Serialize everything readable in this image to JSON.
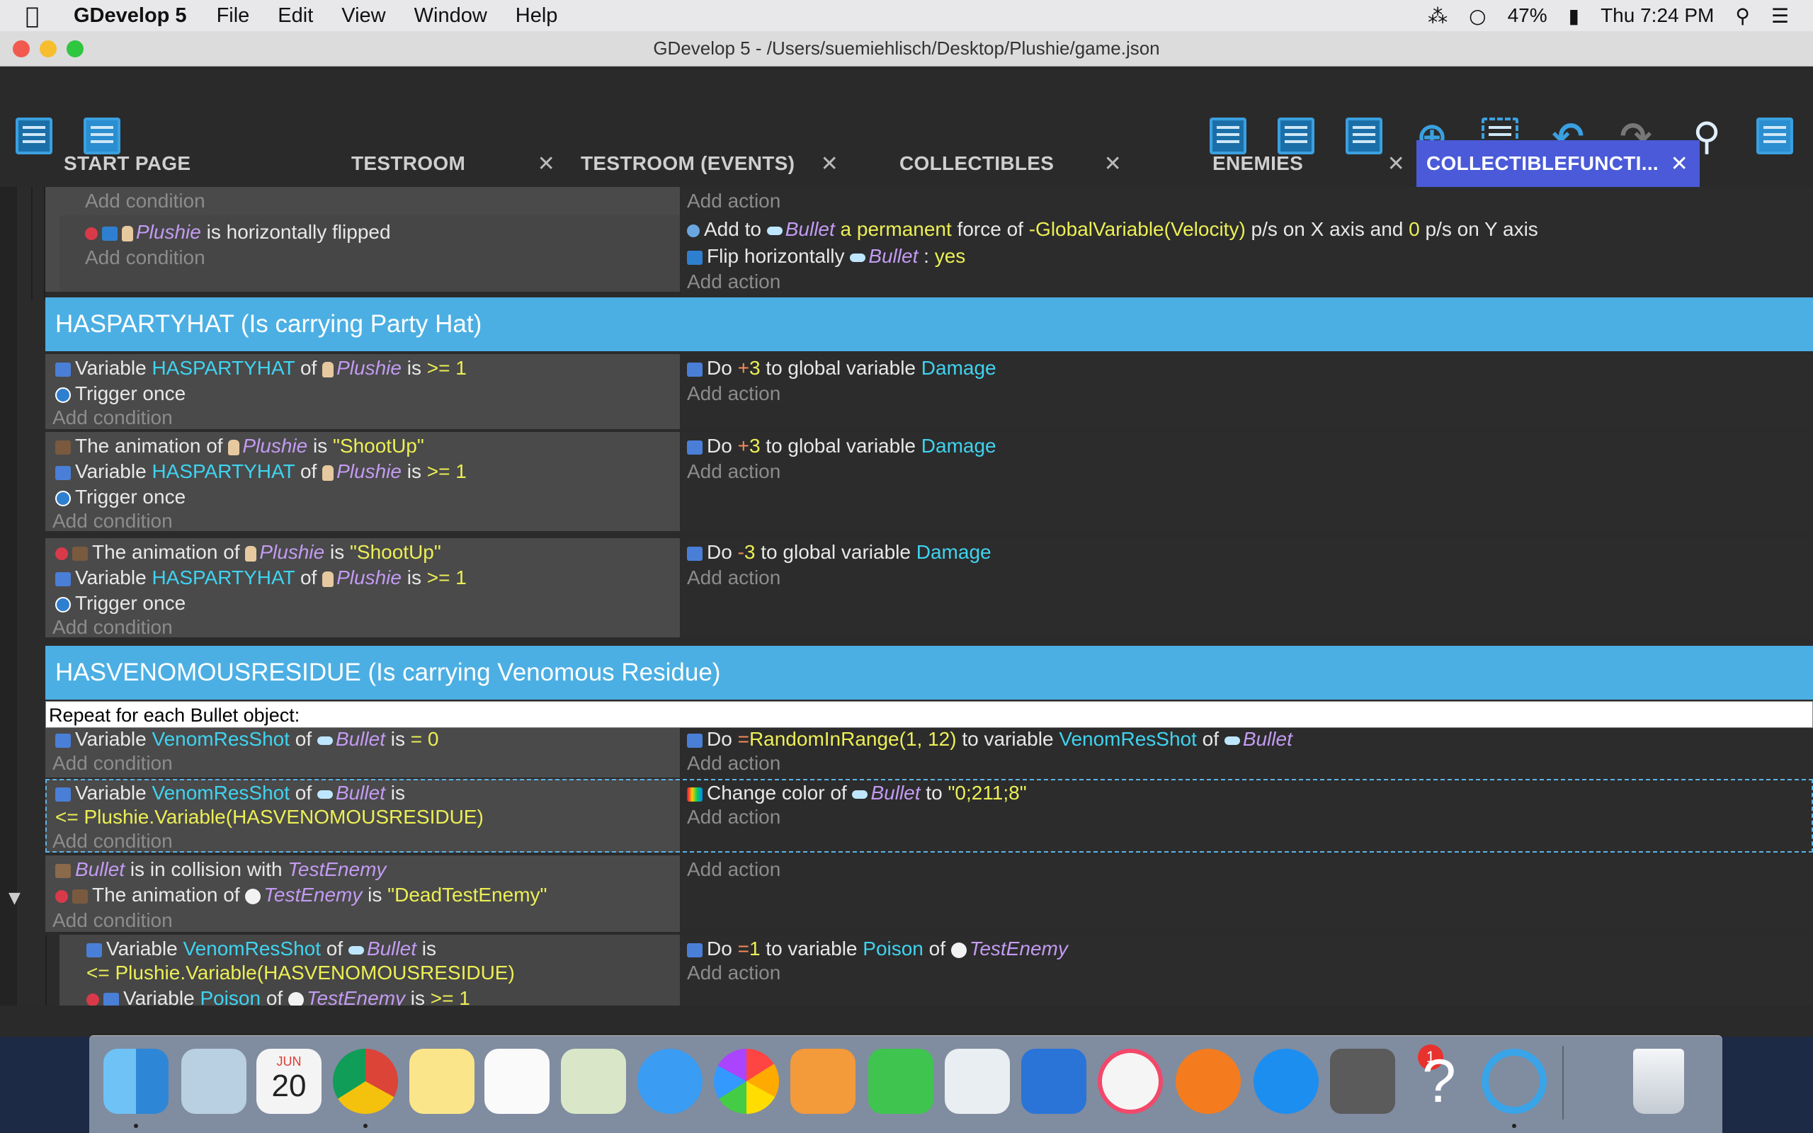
{
  "menubar": {
    "app_name": "GDevelop 5",
    "menus": [
      "File",
      "Edit",
      "View",
      "Window",
      "Help"
    ],
    "battery": "47%",
    "clock": "Thu 7:24 PM"
  },
  "window": {
    "title": "GDevelop 5 - /Users/suemiehlisch/Desktop/Plushie/game.json"
  },
  "tabs": [
    {
      "label": "START PAGE",
      "closable": false
    },
    {
      "label": "TESTROOM",
      "closable": true
    },
    {
      "label": "TESTROOM (EVENTS)",
      "closable": true
    },
    {
      "label": "COLLECTIBLES",
      "closable": true
    },
    {
      "label": "ENEMIES",
      "closable": true
    },
    {
      "label": "COLLECTIBLEFUNCTI...",
      "closable": true,
      "active": true
    }
  ],
  "events": {
    "add_condition": "Add condition",
    "add_action": "Add action",
    "e0": {
      "cond_obj": "Plushie",
      "cond_text": " is horizontally flipped",
      "act1_a": "Add to ",
      "act1_obj": "Bullet",
      "act1_b": " a permanent",
      "act1_c": " force of ",
      "act1_d": "-GlobalVariable(Velocity)",
      "act1_e": " p/s on X axis and ",
      "act1_f": "0",
      "act1_g": " p/s on Y axis",
      "act2_a": "Flip horizontally ",
      "act2_obj": "Bullet",
      "act2_b": " : ",
      "act2_c": "yes"
    },
    "group1": "HASPARTYHAT (Is carrying Party Hat)",
    "e1": {
      "c1_a": "Variable ",
      "c1_var": "HASPARTYHAT",
      "c1_b": " of ",
      "c1_obj": "Plushie",
      "c1_c": " is ",
      "c1_d": ">= 1",
      "c2": "Trigger once",
      "a1_a": "Do ",
      "a1_op": "+",
      "a1_num": "3",
      "a1_b": " to global variable ",
      "a1_var": "Damage"
    },
    "e2": {
      "c1_a": "The animation of ",
      "c1_obj": "Plushie",
      "c1_b": " is ",
      "c1_c": "\"ShootUp\"",
      "c2_a": "Variable ",
      "c2_var": "HASPARTYHAT",
      "c2_b": " of ",
      "c2_obj": "Plushie",
      "c2_c": " is ",
      "c2_d": ">= 1",
      "c3": "Trigger once",
      "a1_a": "Do ",
      "a1_op": "+",
      "a1_num": "3",
      "a1_b": " to global variable ",
      "a1_var": "Damage"
    },
    "e3": {
      "c1_a": "The animation of ",
      "c1_obj": "Plushie",
      "c1_b": " is ",
      "c1_c": "\"ShootUp\"",
      "c2_a": "Variable ",
      "c2_var": "HASPARTYHAT",
      "c2_b": " of ",
      "c2_obj": "Plushie",
      "c2_c": " is ",
      "c2_d": ">= 1",
      "c3": "Trigger once",
      "a1_a": "Do ",
      "a1_op": "-",
      "a1_num": "3",
      "a1_b": " to global variable ",
      "a1_var": "Damage"
    },
    "group2": "HASVENOMOUSRESIDUE (Is carrying Venomous Residue)",
    "repeat": "Repeat for each Bullet object:",
    "e4": {
      "c1_a": "Variable ",
      "c1_var": "VenomResShot",
      "c1_b": " of ",
      "c1_obj": "Bullet",
      "c1_c": " is ",
      "c1_d": "= 0",
      "a1_a": "Do ",
      "a1_op": "=",
      "a1_expr": "RandomInRange(1, 12)",
      "a1_b": " to variable ",
      "a1_var": "VenomResShot",
      "a1_c": " of ",
      "a1_obj": "Bullet"
    },
    "e5": {
      "c1_a": "Variable ",
      "c1_var": "VenomResShot",
      "c1_b": " of ",
      "c1_obj": "Bullet",
      "c1_c": " is",
      "c1_d": "<= Plushie.Variable(HASVENOMOUSRESIDUE)",
      "a1_a": "Change color of ",
      "a1_obj": "Bullet",
      "a1_b": " to ",
      "a1_c": "\"0;211;8\""
    },
    "e6": {
      "c1_obj": "Bullet",
      "c1_a": " is in collision with ",
      "c1_obj2": "TestEnemy",
      "c2_a": "The animation of ",
      "c2_obj": "TestEnemy",
      "c2_b": " is ",
      "c2_c": "\"DeadTestEnemy\""
    },
    "e7": {
      "c1_a": "Variable ",
      "c1_var": "VenomResShot",
      "c1_b": " of ",
      "c1_obj": "Bullet",
      "c1_c": " is",
      "c1_d": "<= Plushie.Variable(HASVENOMOUSRESIDUE)",
      "c2_a": "Variable ",
      "c2_var": "Poison",
      "c2_b": " of ",
      "c2_obj": "TestEnemy",
      "c2_c": " is ",
      "c2_d": ">= 1",
      "a1_a": "Do ",
      "a1_op": "=",
      "a1_num": "1",
      "a1_b": " to variable ",
      "a1_var": "Poison",
      "a1_c": " of ",
      "a1_obj": "TestEnemy"
    }
  },
  "dock": {
    "calendar_month": "JUN",
    "calendar_day": "20",
    "appstore_badge": "1"
  },
  "colors": {
    "group_header": "#4bafe3",
    "active_tab": "#4a5ad8",
    "variable": "#3fd3f0",
    "object": "#c39bf2",
    "value": "#ecef55"
  }
}
